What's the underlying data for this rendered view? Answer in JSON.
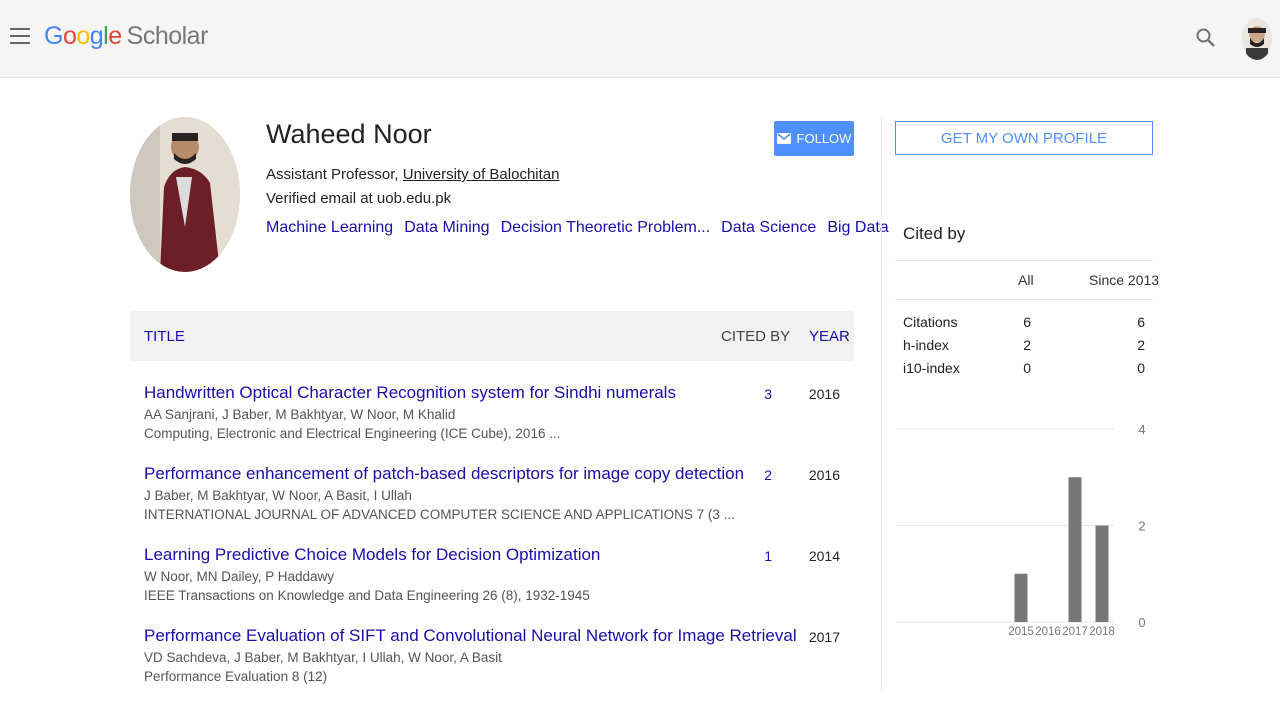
{
  "header": {
    "logo_letters": [
      "G",
      "o",
      "o",
      "g",
      "l",
      "e"
    ],
    "logo_product": "Scholar"
  },
  "profile": {
    "name": "Waheed Noor",
    "position": "Assistant Professor, ",
    "university": "University of Balochitan",
    "email": "Verified email at uob.edu.pk",
    "interests": [
      "Machine Learning",
      "Data Mining",
      "Decision Theoretic Problem...",
      "Data Science",
      "Big Data"
    ],
    "follow_label": "FOLLOW"
  },
  "table": {
    "headers": {
      "title": "TITLE",
      "cited_by": "CITED BY",
      "year": "YEAR"
    },
    "rows": [
      {
        "title": "Handwritten Optical Character Recognition system for Sindhi numerals",
        "authors": "AA Sanjrani, J Baber, M Bakhtyar, W Noor, M Khalid",
        "venue": "Computing, Electronic and Electrical Engineering (ICE Cube), 2016 ...",
        "cited": "3",
        "year": "2016"
      },
      {
        "title": "Performance enhancement of patch-based descriptors for image copy detection",
        "authors": "J Baber, M Bakhtyar, W Noor, A Basit, I Ullah",
        "venue": "INTERNATIONAL JOURNAL OF ADVANCED COMPUTER SCIENCE AND APPLICATIONS 7 (3 ...",
        "cited": "2",
        "year": "2016"
      },
      {
        "title": "Learning Predictive Choice Models for Decision Optimization",
        "authors": "W Noor, MN Dailey, P Haddawy",
        "venue": "IEEE Transactions on Knowledge and Data Engineering 26 (8), 1932-1945",
        "cited": "1",
        "year": "2014"
      },
      {
        "title": "Performance Evaluation of SIFT and Convolutional Neural Network for Image Retrieval",
        "authors": "VD Sachdeva, J Baber, M Bakhtyar, I Ullah, W Noor, A Basit",
        "venue": "Performance Evaluation 8 (12)",
        "cited": "",
        "year": "2017"
      }
    ]
  },
  "sidebar": {
    "own_profile_label": "GET MY OWN PROFILE",
    "cited_by_title": "Cited by",
    "col_all": "All",
    "col_since": "Since 2013",
    "stats": [
      {
        "label": "Citations",
        "all": "6",
        "since": "6"
      },
      {
        "label": "h-index",
        "all": "2",
        "since": "2"
      },
      {
        "label": "i10-index",
        "all": "0",
        "since": "0"
      }
    ]
  },
  "chart_data": {
    "type": "bar",
    "categories": [
      "2015",
      "2016",
      "2017",
      "2018"
    ],
    "values": [
      1,
      0,
      3,
      2
    ],
    "ylim": [
      0,
      4
    ],
    "yticks": [
      "0",
      "2",
      "4"
    ],
    "bar_color": "#777777",
    "grid": true
  },
  "colors": {
    "link": "#1a0dab",
    "accent": "#4d90fe",
    "topbar_bg": "#f5f5f5"
  }
}
